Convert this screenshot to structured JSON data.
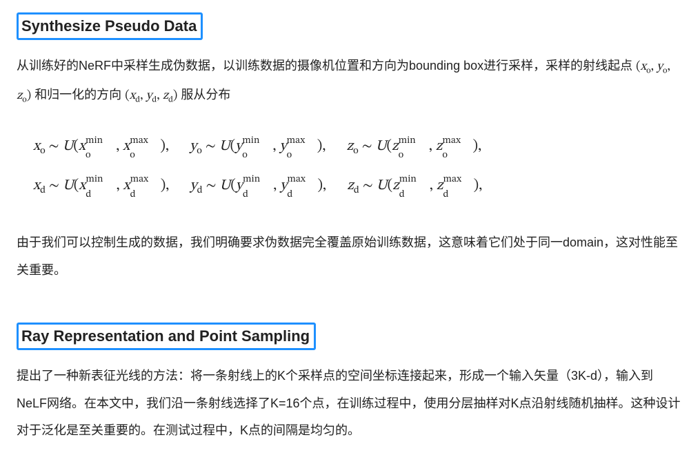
{
  "sections": {
    "synth": {
      "heading": "Synthesize Pseudo Data",
      "para1_prefix": "从训练好的NeRF中采样生成伪数据，以训练数据的摄像机位置和方向为bounding box进行采样，采样的射线起点 ",
      "origin_vec": "(xₒ, yₒ, zₒ)",
      "para1_mid": " 和归一化的方向 ",
      "dir_vec": "(x_d, y_d, z_d)",
      "para1_suffix": " 服从分布",
      "formula_line1": "x_o ~ U(x_o^min, x_o^max),  y_o ~ U(y_o^min, y_o^max),  z_o ~ U(z_o^min, z_o^max),",
      "formula_line2": "x_d ~ U(x_d^min, x_d^max),  y_d ~ U(y_d^min, y_d^max),  z_d ~ U(z_d^min, z_d^max),",
      "para2": "由于我们可以控制生成的数据，我们明确要求伪数据完全覆盖原始训练数据，这意味着它们处于同一domain，这对性能至关重要。"
    },
    "rayrep": {
      "heading": "Ray Representation and Point Sampling",
      "para1": "提出了一种新表征光线的方法：将一条射线上的K个采样点的空间坐标连接起来，形成一个输入矢量（3K-d），输入到NeLF网络。在本文中，我们沿一条射线选择了K=16个点，在训练过程中，使用分层抽样对K点沿射线随机抽样。这种设计对于泛化是至关重要的。在测试过程中，K点的间隔是均匀的。"
    }
  }
}
